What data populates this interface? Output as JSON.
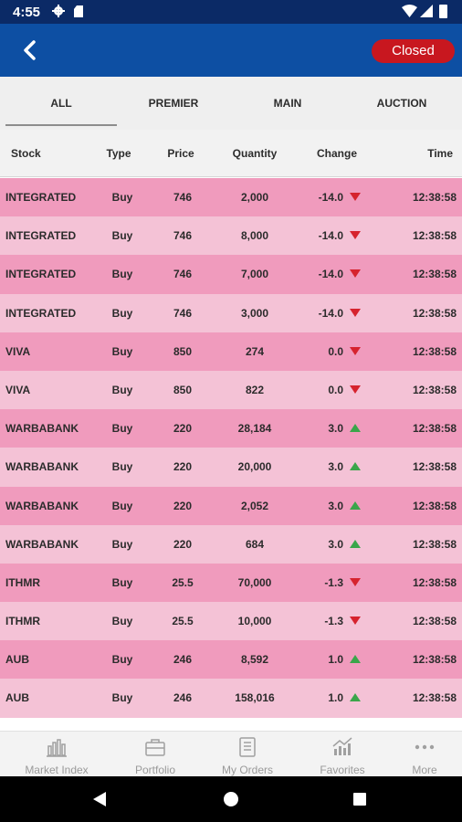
{
  "status_bar": {
    "time": "4:55"
  },
  "app_bar": {
    "status_label": "Closed",
    "status_color": "#c8171f",
    "bar_color": "#0d4fa3"
  },
  "tabs": [
    {
      "label": "ALL",
      "active": true
    },
    {
      "label": "PREMIER",
      "active": false
    },
    {
      "label": "MAIN",
      "active": false
    },
    {
      "label": "AUCTION",
      "active": false
    }
  ],
  "table": {
    "columns": [
      "Stock",
      "Type",
      "Price",
      "Quantity",
      "Change",
      "Time"
    ],
    "rows": [
      {
        "stock": "INTEGRATED",
        "type": "Buy",
        "price": "746",
        "quantity": "2,000",
        "change": "-14.0",
        "direction": "down",
        "time": "12:38:58"
      },
      {
        "stock": "INTEGRATED",
        "type": "Buy",
        "price": "746",
        "quantity": "8,000",
        "change": "-14.0",
        "direction": "down",
        "time": "12:38:58"
      },
      {
        "stock": "INTEGRATED",
        "type": "Buy",
        "price": "746",
        "quantity": "7,000",
        "change": "-14.0",
        "direction": "down",
        "time": "12:38:58"
      },
      {
        "stock": "INTEGRATED",
        "type": "Buy",
        "price": "746",
        "quantity": "3,000",
        "change": "-14.0",
        "direction": "down",
        "time": "12:38:58"
      },
      {
        "stock": "VIVA",
        "type": "Buy",
        "price": "850",
        "quantity": "274",
        "change": "0.0",
        "direction": "down",
        "time": "12:38:58"
      },
      {
        "stock": "VIVA",
        "type": "Buy",
        "price": "850",
        "quantity": "822",
        "change": "0.0",
        "direction": "down",
        "time": "12:38:58"
      },
      {
        "stock": "WARBABANK",
        "type": "Buy",
        "price": "220",
        "quantity": "28,184",
        "change": "3.0",
        "direction": "up",
        "time": "12:38:58"
      },
      {
        "stock": "WARBABANK",
        "type": "Buy",
        "price": "220",
        "quantity": "20,000",
        "change": "3.0",
        "direction": "up",
        "time": "12:38:58"
      },
      {
        "stock": "WARBABANK",
        "type": "Buy",
        "price": "220",
        "quantity": "2,052",
        "change": "3.0",
        "direction": "up",
        "time": "12:38:58"
      },
      {
        "stock": "WARBABANK",
        "type": "Buy",
        "price": "220",
        "quantity": "684",
        "change": "3.0",
        "direction": "up",
        "time": "12:38:58"
      },
      {
        "stock": "ITHMR",
        "type": "Buy",
        "price": "25.5",
        "quantity": "70,000",
        "change": "-1.3",
        "direction": "down",
        "time": "12:38:58"
      },
      {
        "stock": "ITHMR",
        "type": "Buy",
        "price": "25.5",
        "quantity": "10,000",
        "change": "-1.3",
        "direction": "down",
        "time": "12:38:58"
      },
      {
        "stock": "AUB",
        "type": "Buy",
        "price": "246",
        "quantity": "8,592",
        "change": "1.0",
        "direction": "up",
        "time": "12:38:58"
      },
      {
        "stock": "AUB",
        "type": "Buy",
        "price": "246",
        "quantity": "158,016",
        "change": "1.0",
        "direction": "up",
        "time": "12:38:58"
      }
    ]
  },
  "bottom_nav": [
    {
      "label": "Market Index",
      "icon": "bar-chart-icon"
    },
    {
      "label": "Portfolio",
      "icon": "briefcase-icon"
    },
    {
      "label": "My Orders",
      "icon": "orders-list-icon"
    },
    {
      "label": "Favorites",
      "icon": "trend-chart-icon"
    },
    {
      "label": "More",
      "icon": "more-dots-icon"
    }
  ],
  "colors": {
    "row_dark": "#f09bbd",
    "row_light": "#f4c2d6",
    "arrow_down": "#d6232e",
    "arrow_up": "#3aa64a"
  }
}
